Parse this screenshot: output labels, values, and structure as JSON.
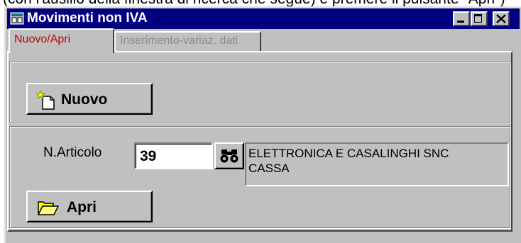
{
  "caption": "(con l'ausilio della finestra di ricerca che segue) e premere il pulsante \"Apri\")",
  "window": {
    "title": "Movimenti non IVA"
  },
  "tabs": [
    {
      "label": "Nuovo/Apri",
      "active": true
    },
    {
      "label": "Inserimento-variaz. dati",
      "active": false
    }
  ],
  "new_section": {
    "new_button_label": "Nuovo"
  },
  "open_section": {
    "article_label": "N.Articolo",
    "article_value": "39",
    "description_line1": "ELETTRONICA E CASALINGHI SNC",
    "description_line2": "CASSA",
    "open_button_label": "Apri"
  },
  "icons": [
    "app-window-icon",
    "minimize-icon",
    "maximize-icon",
    "close-icon",
    "new-document-icon",
    "binoculars-search-icon",
    "open-folder-icon"
  ],
  "colors": {
    "titlebar": "#000080",
    "face": "#c0c0c0",
    "active_tab_text": "#c00000",
    "disabled_text": "#8a8a8a"
  }
}
